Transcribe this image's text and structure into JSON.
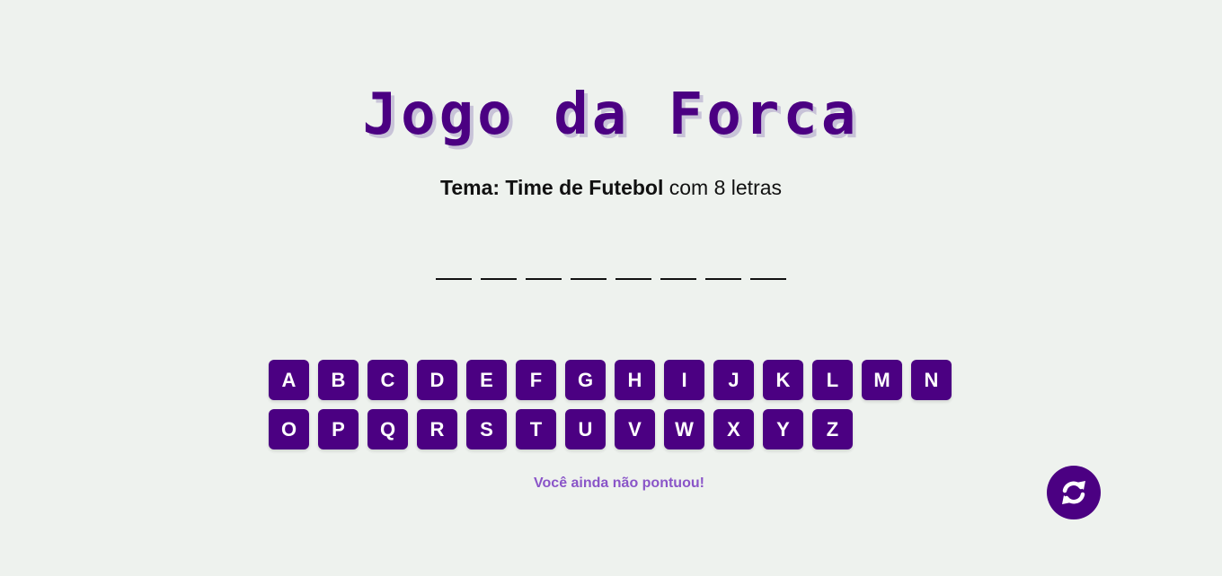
{
  "header": {
    "title": "Jogo da Forca"
  },
  "theme": {
    "label": "Tema:",
    "name": "Time de Futebol",
    "suffix": "com 8 letras"
  },
  "word": {
    "slots": [
      "",
      "",
      "",
      "",
      "",
      "",
      "",
      ""
    ]
  },
  "keyboard": {
    "keys": [
      "A",
      "B",
      "C",
      "D",
      "E",
      "F",
      "G",
      "H",
      "I",
      "J",
      "K",
      "L",
      "M",
      "N",
      "O",
      "P",
      "Q",
      "R",
      "S",
      "T",
      "U",
      "V",
      "W",
      "X",
      "Y",
      "Z"
    ]
  },
  "score": {
    "message": "Você ainda não pontuou!"
  },
  "restart_button": {
    "icon": "refresh-icon"
  },
  "colors": {
    "accent": "#4b0082",
    "background": "#eef2ee",
    "score_text": "#8a55c8"
  }
}
